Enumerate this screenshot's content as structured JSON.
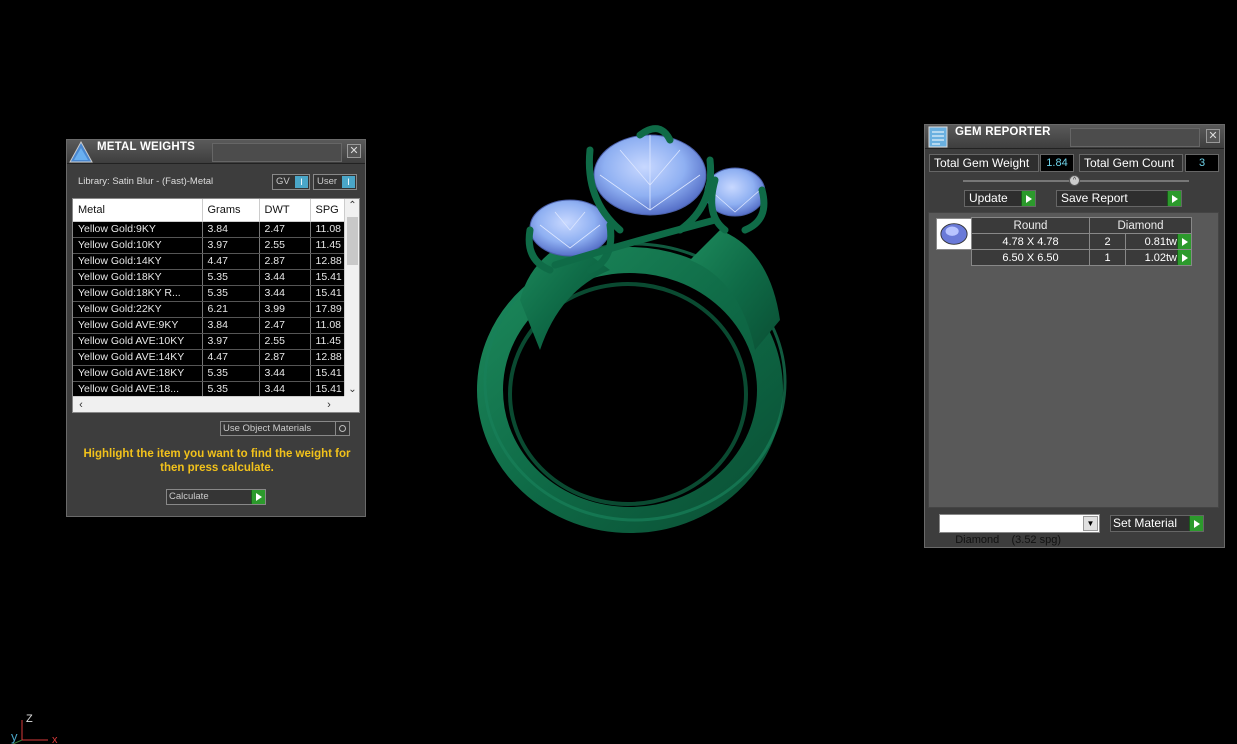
{
  "metal_weights": {
    "title": "METAL WEIGHTS",
    "library_label": "Library: Satin Blur - (Fast)-Metal",
    "toggle_gv": "GV",
    "toggle_user": "User",
    "toggle_glyph": "I",
    "columns": [
      "Metal",
      "Grams",
      "DWT",
      "SPG"
    ],
    "rows": [
      [
        "Yellow Gold:9KY",
        "3.84",
        "2.47",
        "11.08"
      ],
      [
        "Yellow Gold:10KY",
        "3.97",
        "2.55",
        "11.45"
      ],
      [
        "Yellow Gold:14KY",
        "4.47",
        "2.87",
        "12.88"
      ],
      [
        "Yellow Gold:18KY",
        "5.35",
        "3.44",
        "15.41"
      ],
      [
        "Yellow Gold:18KY R...",
        "5.35",
        "3.44",
        "15.41"
      ],
      [
        "Yellow Gold:22KY",
        "6.21",
        "3.99",
        "17.89"
      ],
      [
        "Yellow Gold AVE:9KY",
        "3.84",
        "2.47",
        "11.08"
      ],
      [
        "Yellow Gold AVE:10KY",
        "3.97",
        "2.55",
        "11.45"
      ],
      [
        "Yellow Gold AVE:14KY",
        "4.47",
        "2.87",
        "12.88"
      ],
      [
        "Yellow Gold AVE:18KY",
        "5.35",
        "3.44",
        "15.41"
      ],
      [
        "Yellow Gold AVE:18...",
        "5.35",
        "3.44",
        "15.41"
      ]
    ],
    "use_object_materials": "Use Object Materials",
    "hint": "Highlight the item you want to find the weight for then press calculate.",
    "calculate_label": "Calculate"
  },
  "gem_reporter": {
    "title": "GEM REPORTER",
    "total_weight_label": "Total Gem Weight",
    "total_weight_value": "1.84",
    "total_count_label": "Total Gem Count",
    "total_count_value": "3",
    "update_label": "Update",
    "save_report_label": "Save Report",
    "headers": [
      "Round",
      "Diamond"
    ],
    "gems": [
      {
        "size": "4.78 X 4.78",
        "count": "2",
        "weight": "0.81tw"
      },
      {
        "size": "6.50 X 6.50",
        "count": "1",
        "weight": "1.02tw"
      }
    ],
    "material_select": "Diamond    (3.52 spg)",
    "set_material_label": "Set Material"
  },
  "viewport": {
    "axis_z": "Z",
    "axis_y": "y",
    "axis_x": "x",
    "colors": {
      "metal": "#0f6b47",
      "gem": "#8fb0f2",
      "background": "#000000"
    }
  }
}
